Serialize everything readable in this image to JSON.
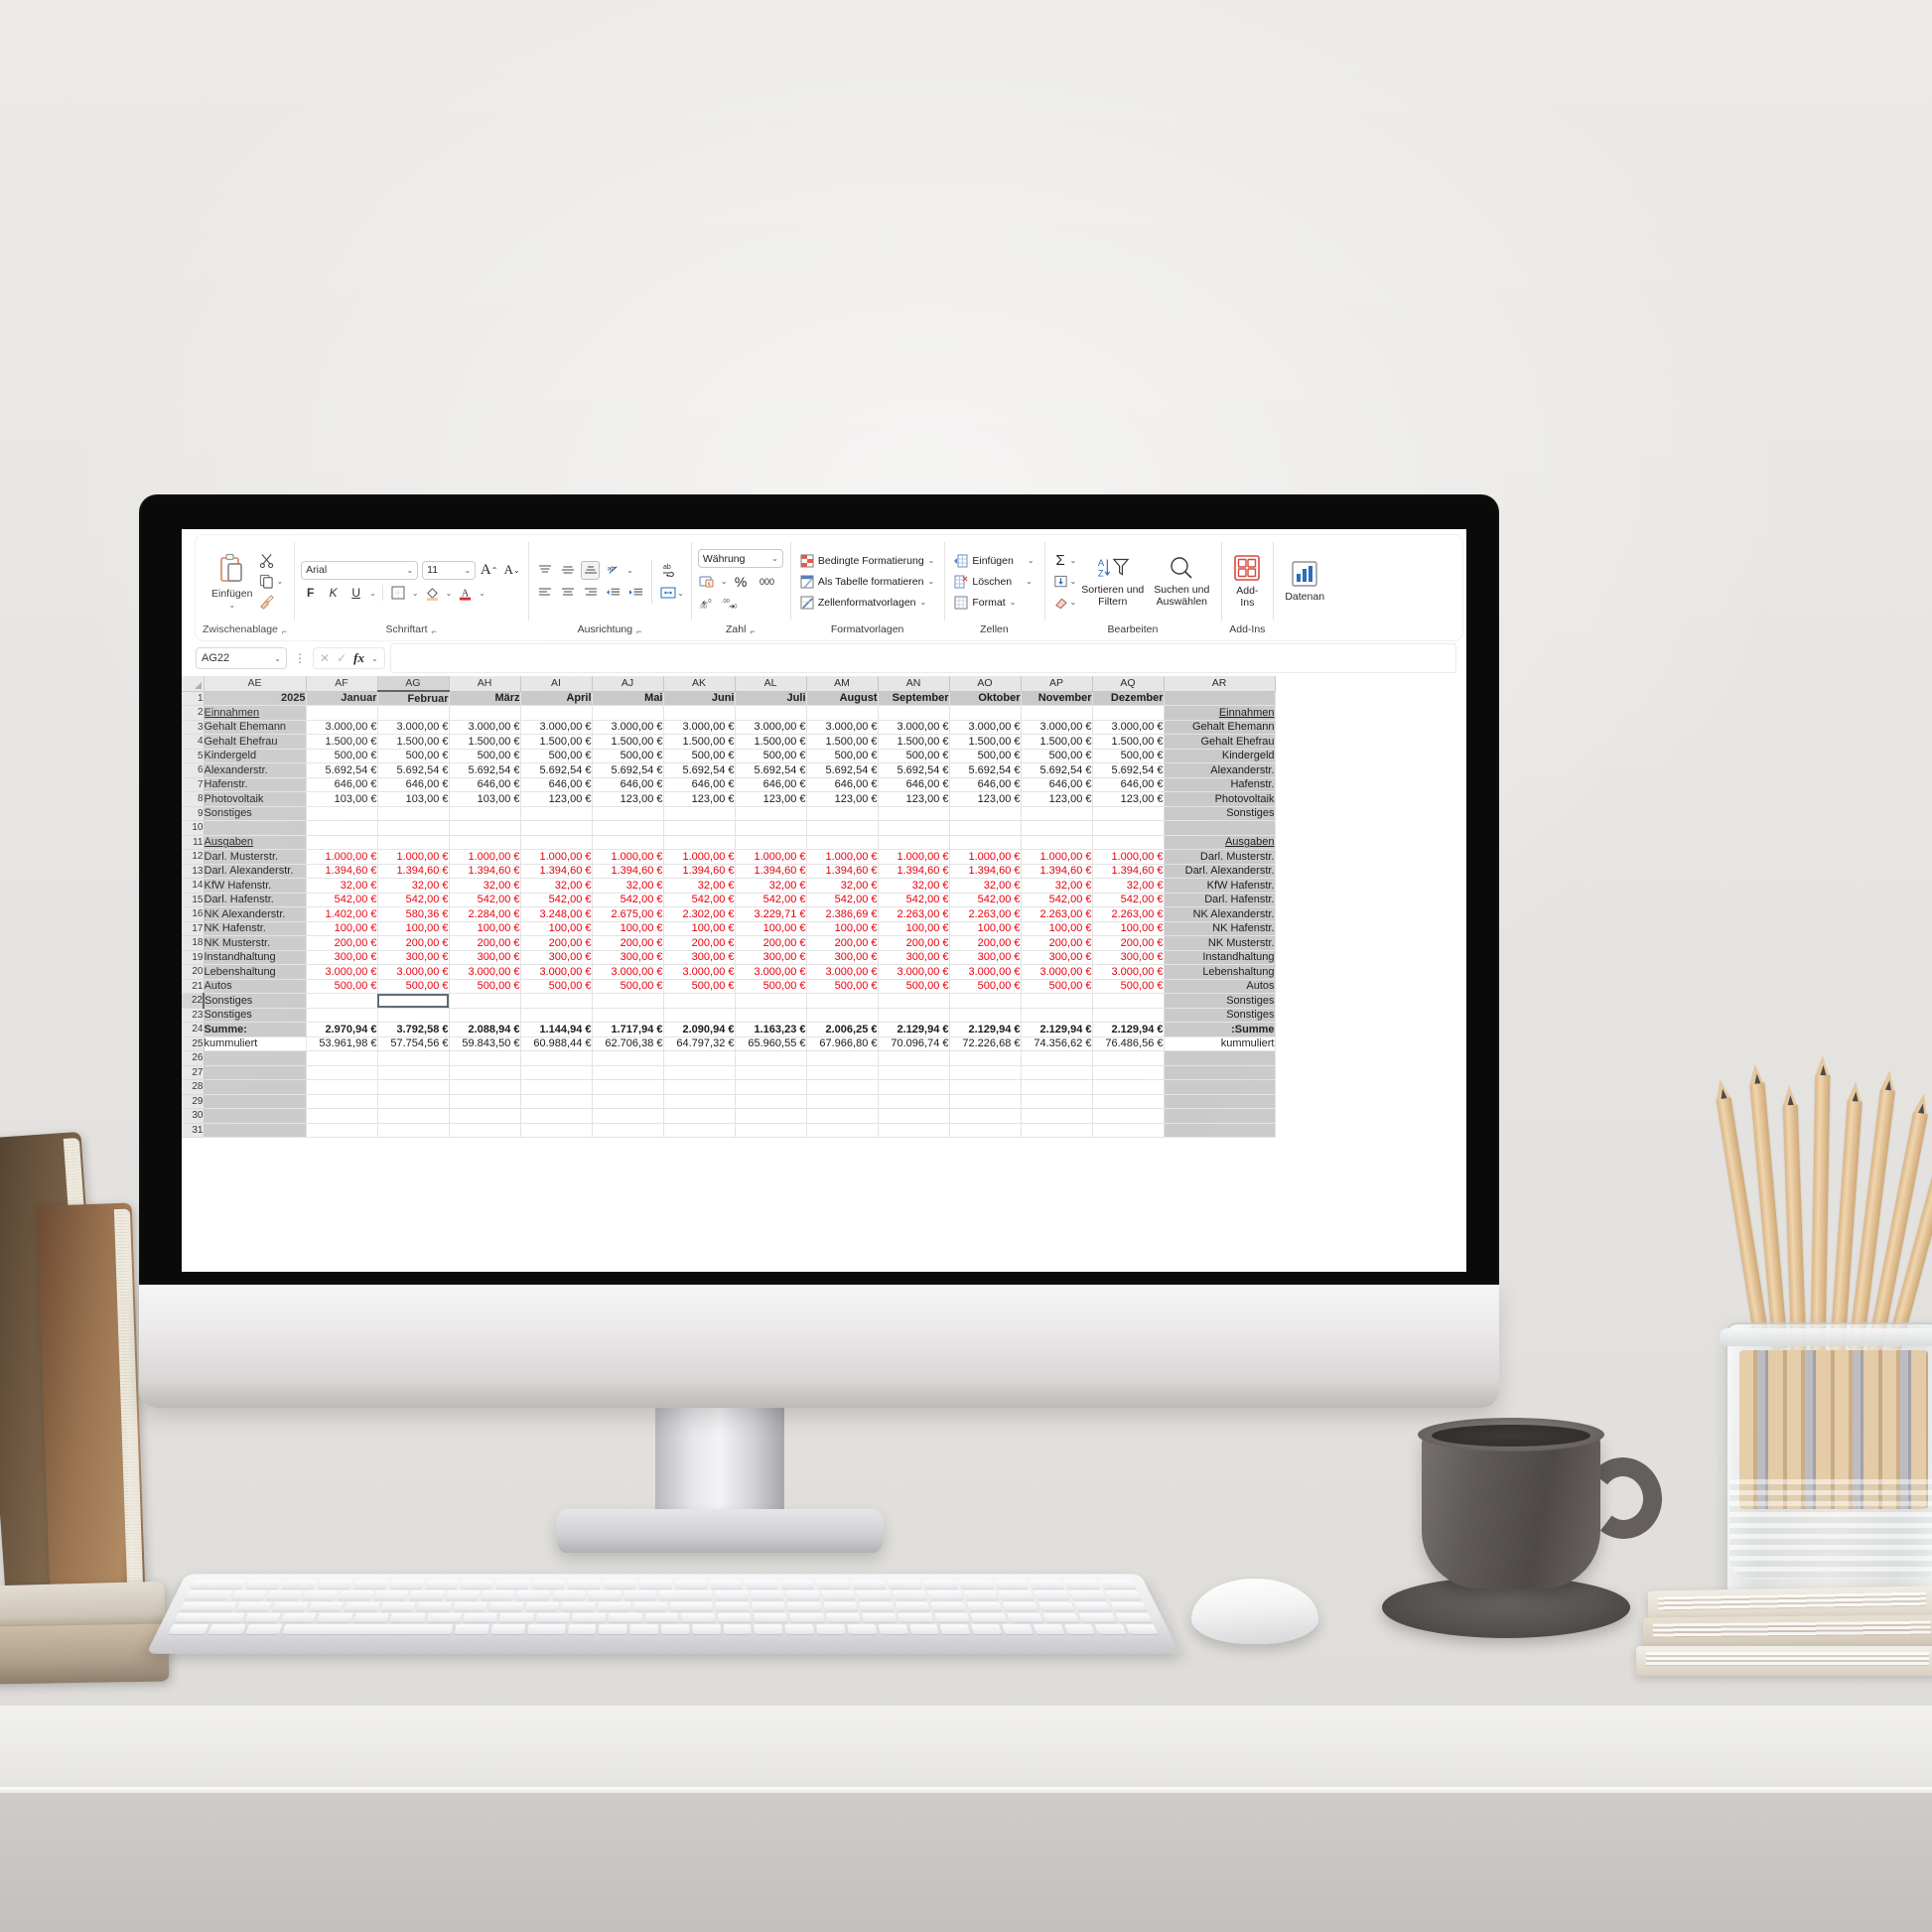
{
  "app": {
    "name_box_value": "AG22",
    "formula_value": ""
  },
  "ribbon": {
    "groups": [
      {
        "name": "Zwischenablage",
        "label": "Zwischenablage"
      },
      {
        "name": "Schriftart",
        "label": "Schriftart"
      },
      {
        "name": "Ausrichtung",
        "label": "Ausrichtung"
      },
      {
        "name": "Zahl",
        "label": "Zahl"
      },
      {
        "name": "Formatvorlagen",
        "label": "Formatvorlagen"
      },
      {
        "name": "Zellen",
        "label": "Zellen"
      },
      {
        "name": "Bearbeiten",
        "label": "Bearbeiten"
      },
      {
        "name": "Add-Ins",
        "label": "Add-Ins"
      }
    ],
    "clipboard": {
      "paste_label": "Einfügen",
      "cut_icon": "scissors-icon",
      "copy_icon": "copy-icon",
      "format_painter_icon": "format-painter-icon"
    },
    "font": {
      "family": "Arial",
      "size": "11",
      "grow_label": "A",
      "shrink_label": "A",
      "bold": "F",
      "italic": "K",
      "underline": "U"
    },
    "number": {
      "format": "Währung",
      "percent": "%",
      "thousands": "000"
    },
    "styles": {
      "conditional": "Bedingte Formatierung",
      "as_table": "Als Tabelle formatieren",
      "cell_styles": "Zellenformatvorlagen"
    },
    "cells": {
      "insert": "Einfügen",
      "delete": "Löschen",
      "format": "Format"
    },
    "editing": {
      "sort_filter_line1": "Sortieren und",
      "sort_filter_line2": "Filtern",
      "find_select_line1": "Suchen und",
      "find_select_line2": "Auswählen"
    },
    "addins": {
      "line1": "Add-",
      "line2": "Ins"
    },
    "data_analysis": {
      "label": "Datenan"
    }
  },
  "sheet": {
    "columns": [
      "AE",
      "AF",
      "AG",
      "AH",
      "AI",
      "AJ",
      "AK",
      "AL",
      "AM",
      "AN",
      "AO",
      "AP",
      "AQ",
      "AR"
    ],
    "selected_column": "AG",
    "selected_row": 22,
    "row_numbers": [
      1,
      2,
      3,
      4,
      5,
      6,
      7,
      8,
      9,
      10,
      11,
      12,
      13,
      14,
      15,
      16,
      17,
      18,
      19,
      20,
      21,
      22,
      23,
      24,
      25,
      26,
      27,
      28,
      29,
      30,
      31
    ],
    "header_row": {
      "year": "2025",
      "months": [
        "Januar",
        "Februar",
        "März",
        "April",
        "Mai",
        "Juni",
        "Juli",
        "August",
        "September",
        "Oktober",
        "November",
        "Dezember"
      ],
      "right_blank": ""
    },
    "section_income": {
      "title": "Einnahmen",
      "title_right": "Einnahmen"
    },
    "section_expense": {
      "title": "Ausgaben",
      "title_right": "Ausgaben"
    },
    "rows": [
      {
        "row": 2,
        "type": "section",
        "label": "Einnahmen",
        "label_right": "Einnahmen",
        "values": [
          "",
          "",
          "",
          "",
          "",
          "",
          "",
          "",
          "",
          "",
          "",
          ""
        ]
      },
      {
        "row": 3,
        "type": "income",
        "label": "Gehalt Ehemann",
        "label_right": "Gehalt Ehemann",
        "values": [
          "3.000,00 €",
          "3.000,00 €",
          "3.000,00 €",
          "3.000,00 €",
          "3.000,00 €",
          "3.000,00 €",
          "3.000,00 €",
          "3.000,00 €",
          "3.000,00 €",
          "3.000,00 €",
          "3.000,00 €",
          "3.000,00 €"
        ]
      },
      {
        "row": 4,
        "type": "income",
        "label": "Gehalt Ehefrau",
        "label_right": "Gehalt Ehefrau",
        "values": [
          "1.500,00 €",
          "1.500,00 €",
          "1.500,00 €",
          "1.500,00 €",
          "1.500,00 €",
          "1.500,00 €",
          "1.500,00 €",
          "1.500,00 €",
          "1.500,00 €",
          "1.500,00 €",
          "1.500,00 €",
          "1.500,00 €"
        ]
      },
      {
        "row": 5,
        "type": "income",
        "label": "Kindergeld",
        "label_right": "Kindergeld",
        "values": [
          "500,00 €",
          "500,00 €",
          "500,00 €",
          "500,00 €",
          "500,00 €",
          "500,00 €",
          "500,00 €",
          "500,00 €",
          "500,00 €",
          "500,00 €",
          "500,00 €",
          "500,00 €"
        ]
      },
      {
        "row": 6,
        "type": "income",
        "label": "Alexanderstr.",
        "label_right": "Alexanderstr.",
        "values": [
          "5.692,54 €",
          "5.692,54 €",
          "5.692,54 €",
          "5.692,54 €",
          "5.692,54 €",
          "5.692,54 €",
          "5.692,54 €",
          "5.692,54 €",
          "5.692,54 €",
          "5.692,54 €",
          "5.692,54 €",
          "5.692,54 €"
        ]
      },
      {
        "row": 7,
        "type": "income",
        "label": "Hafenstr.",
        "label_right": "Hafenstr.",
        "values": [
          "646,00 €",
          "646,00 €",
          "646,00 €",
          "646,00 €",
          "646,00 €",
          "646,00 €",
          "646,00 €",
          "646,00 €",
          "646,00 €",
          "646,00 €",
          "646,00 €",
          "646,00 €"
        ]
      },
      {
        "row": 8,
        "type": "income",
        "label": "Photovoltaik",
        "label_right": "Photovoltaik",
        "values": [
          "103,00 €",
          "103,00 €",
          "103,00 €",
          "123,00 €",
          "123,00 €",
          "123,00 €",
          "123,00 €",
          "123,00 €",
          "123,00 €",
          "123,00 €",
          "123,00 €",
          "123,00 €"
        ]
      },
      {
        "row": 9,
        "type": "income",
        "label": "Sonstiges",
        "label_right": "Sonstiges",
        "values": [
          "",
          "",
          "",
          "",
          "",
          "",
          "",
          "",
          "",
          "",
          "",
          ""
        ]
      },
      {
        "row": 10,
        "type": "blank",
        "label": "",
        "label_right": "",
        "values": [
          "",
          "",
          "",
          "",
          "",
          "",
          "",
          "",
          "",
          "",
          "",
          ""
        ]
      },
      {
        "row": 11,
        "type": "section",
        "label": "Ausgaben",
        "label_right": "Ausgaben",
        "values": [
          "",
          "",
          "",
          "",
          "",
          "",
          "",
          "",
          "",
          "",
          "",
          ""
        ]
      },
      {
        "row": 12,
        "type": "expense",
        "label": "Darl. Musterstr.",
        "label_right": "Darl. Musterstr.",
        "values": [
          "1.000,00 €",
          "1.000,00 €",
          "1.000,00 €",
          "1.000,00 €",
          "1.000,00 €",
          "1.000,00 €",
          "1.000,00 €",
          "1.000,00 €",
          "1.000,00 €",
          "1.000,00 €",
          "1.000,00 €",
          "1.000,00 €"
        ]
      },
      {
        "row": 13,
        "type": "expense",
        "label": "Darl. Alexanderstr.",
        "label_right": "Darl. Alexanderstr.",
        "values": [
          "1.394,60 €",
          "1.394,60 €",
          "1.394,60 €",
          "1.394,60 €",
          "1.394,60 €",
          "1.394,60 €",
          "1.394,60 €",
          "1.394,60 €",
          "1.394,60 €",
          "1.394,60 €",
          "1.394,60 €",
          "1.394,60 €"
        ]
      },
      {
        "row": 14,
        "type": "expense",
        "label": "KfW Hafenstr.",
        "label_right": "KfW Hafenstr.",
        "values": [
          "32,00 €",
          "32,00 €",
          "32,00 €",
          "32,00 €",
          "32,00 €",
          "32,00 €",
          "32,00 €",
          "32,00 €",
          "32,00 €",
          "32,00 €",
          "32,00 €",
          "32,00 €"
        ]
      },
      {
        "row": 15,
        "type": "expense",
        "label": "Darl. Hafenstr.",
        "label_right": "Darl. Hafenstr.",
        "values": [
          "542,00 €",
          "542,00 €",
          "542,00 €",
          "542,00 €",
          "542,00 €",
          "542,00 €",
          "542,00 €",
          "542,00 €",
          "542,00 €",
          "542,00 €",
          "542,00 €",
          "542,00 €"
        ]
      },
      {
        "row": 16,
        "type": "expense",
        "label": "NK Alexanderstr.",
        "label_right": "NK Alexanderstr.",
        "values": [
          "1.402,00 €",
          "580,36 €",
          "2.284,00 €",
          "3.248,00 €",
          "2.675,00 €",
          "2.302,00 €",
          "3.229,71 €",
          "2.386,69 €",
          "2.263,00 €",
          "2.263,00 €",
          "2.263,00 €",
          "2.263,00 €"
        ]
      },
      {
        "row": 17,
        "type": "expense",
        "label": "NK Hafenstr.",
        "label_right": "NK Hafenstr.",
        "values": [
          "100,00 €",
          "100,00 €",
          "100,00 €",
          "100,00 €",
          "100,00 €",
          "100,00 €",
          "100,00 €",
          "100,00 €",
          "100,00 €",
          "100,00 €",
          "100,00 €",
          "100,00 €"
        ]
      },
      {
        "row": 18,
        "type": "expense",
        "label": "NK Musterstr.",
        "label_right": "NK Musterstr.",
        "values": [
          "200,00 €",
          "200,00 €",
          "200,00 €",
          "200,00 €",
          "200,00 €",
          "200,00 €",
          "200,00 €",
          "200,00 €",
          "200,00 €",
          "200,00 €",
          "200,00 €",
          "200,00 €"
        ]
      },
      {
        "row": 19,
        "type": "expense",
        "label": "Instandhaltung",
        "label_right": "Instandhaltung",
        "values": [
          "300,00 €",
          "300,00 €",
          "300,00 €",
          "300,00 €",
          "300,00 €",
          "300,00 €",
          "300,00 €",
          "300,00 €",
          "300,00 €",
          "300,00 €",
          "300,00 €",
          "300,00 €"
        ]
      },
      {
        "row": 20,
        "type": "expense",
        "label": "Lebenshaltung",
        "label_right": "Lebenshaltung",
        "values": [
          "3.000,00 €",
          "3.000,00 €",
          "3.000,00 €",
          "3.000,00 €",
          "3.000,00 €",
          "3.000,00 €",
          "3.000,00 €",
          "3.000,00 €",
          "3.000,00 €",
          "3.000,00 €",
          "3.000,00 €",
          "3.000,00 €"
        ]
      },
      {
        "row": 21,
        "type": "expense",
        "label": "Autos",
        "label_right": "Autos",
        "values": [
          "500,00 €",
          "500,00 €",
          "500,00 €",
          "500,00 €",
          "500,00 €",
          "500,00 €",
          "500,00 €",
          "500,00 €",
          "500,00 €",
          "500,00 €",
          "500,00 €",
          "500,00 €"
        ]
      },
      {
        "row": 22,
        "type": "expense",
        "label": "Sonstiges",
        "label_right": "Sonstiges",
        "values": [
          "",
          "",
          "",
          "",
          "",
          "",
          "",
          "",
          "",
          "",
          "",
          ""
        ]
      },
      {
        "row": 23,
        "type": "expense",
        "label": "Sonstiges",
        "label_right": "Sonstiges",
        "values": [
          "",
          "",
          "",
          "",
          "",
          "",
          "",
          "",
          "",
          "",
          "",
          ""
        ]
      },
      {
        "row": 24,
        "type": "total",
        "label": "Summe:",
        "label_right": ":Summe",
        "values": [
          "2.970,94 €",
          "3.792,58 €",
          "2.088,94 €",
          "1.144,94 €",
          "1.717,94 €",
          "2.090,94 €",
          "1.163,23 €",
          "2.006,25 €",
          "2.129,94 €",
          "2.129,94 €",
          "2.129,94 €",
          "2.129,94 €"
        ]
      },
      {
        "row": 25,
        "type": "cumulative",
        "label": "kummuliert",
        "label_right": "kummuliert",
        "values": [
          "53.961,98 €",
          "57.754,56 €",
          "59.843,50 €",
          "60.988,44 €",
          "62.706,38 €",
          "64.797,32 €",
          "65.960,55 €",
          "67.966,80 €",
          "70.096,74 €",
          "72.226,68 €",
          "74.356,62 €",
          "76.486,56 €"
        ]
      },
      {
        "row": 26,
        "type": "blank",
        "label": "",
        "label_right": "",
        "values": [
          "",
          "",
          "",
          "",
          "",
          "",
          "",
          "",
          "",
          "",
          "",
          ""
        ]
      },
      {
        "row": 27,
        "type": "blank",
        "label": "",
        "label_right": "",
        "values": [
          "",
          "",
          "",
          "",
          "",
          "",
          "",
          "",
          "",
          "",
          "",
          ""
        ]
      },
      {
        "row": 28,
        "type": "blank",
        "label": "",
        "label_right": "",
        "values": [
          "",
          "",
          "",
          "",
          "",
          "",
          "",
          "",
          "",
          "",
          "",
          ""
        ]
      },
      {
        "row": 29,
        "type": "blank",
        "label": "",
        "label_right": "",
        "values": [
          "",
          "",
          "",
          "",
          "",
          "",
          "",
          "",
          "",
          "",
          "",
          ""
        ]
      },
      {
        "row": 30,
        "type": "blank",
        "label": "",
        "label_right": "",
        "values": [
          "",
          "",
          "",
          "",
          "",
          "",
          "",
          "",
          "",
          "",
          "",
          ""
        ]
      },
      {
        "row": 31,
        "type": "blank",
        "label": "",
        "label_right": "",
        "values": [
          "",
          "",
          "",
          "",
          "",
          "",
          "",
          "",
          "",
          "",
          "",
          ""
        ]
      }
    ]
  },
  "colors": {
    "expense_red": "#e8000d",
    "header_gray": "#c9c9c9",
    "colheader_gray": "#e6e6e6",
    "selection_outline": "#5b6b72"
  }
}
